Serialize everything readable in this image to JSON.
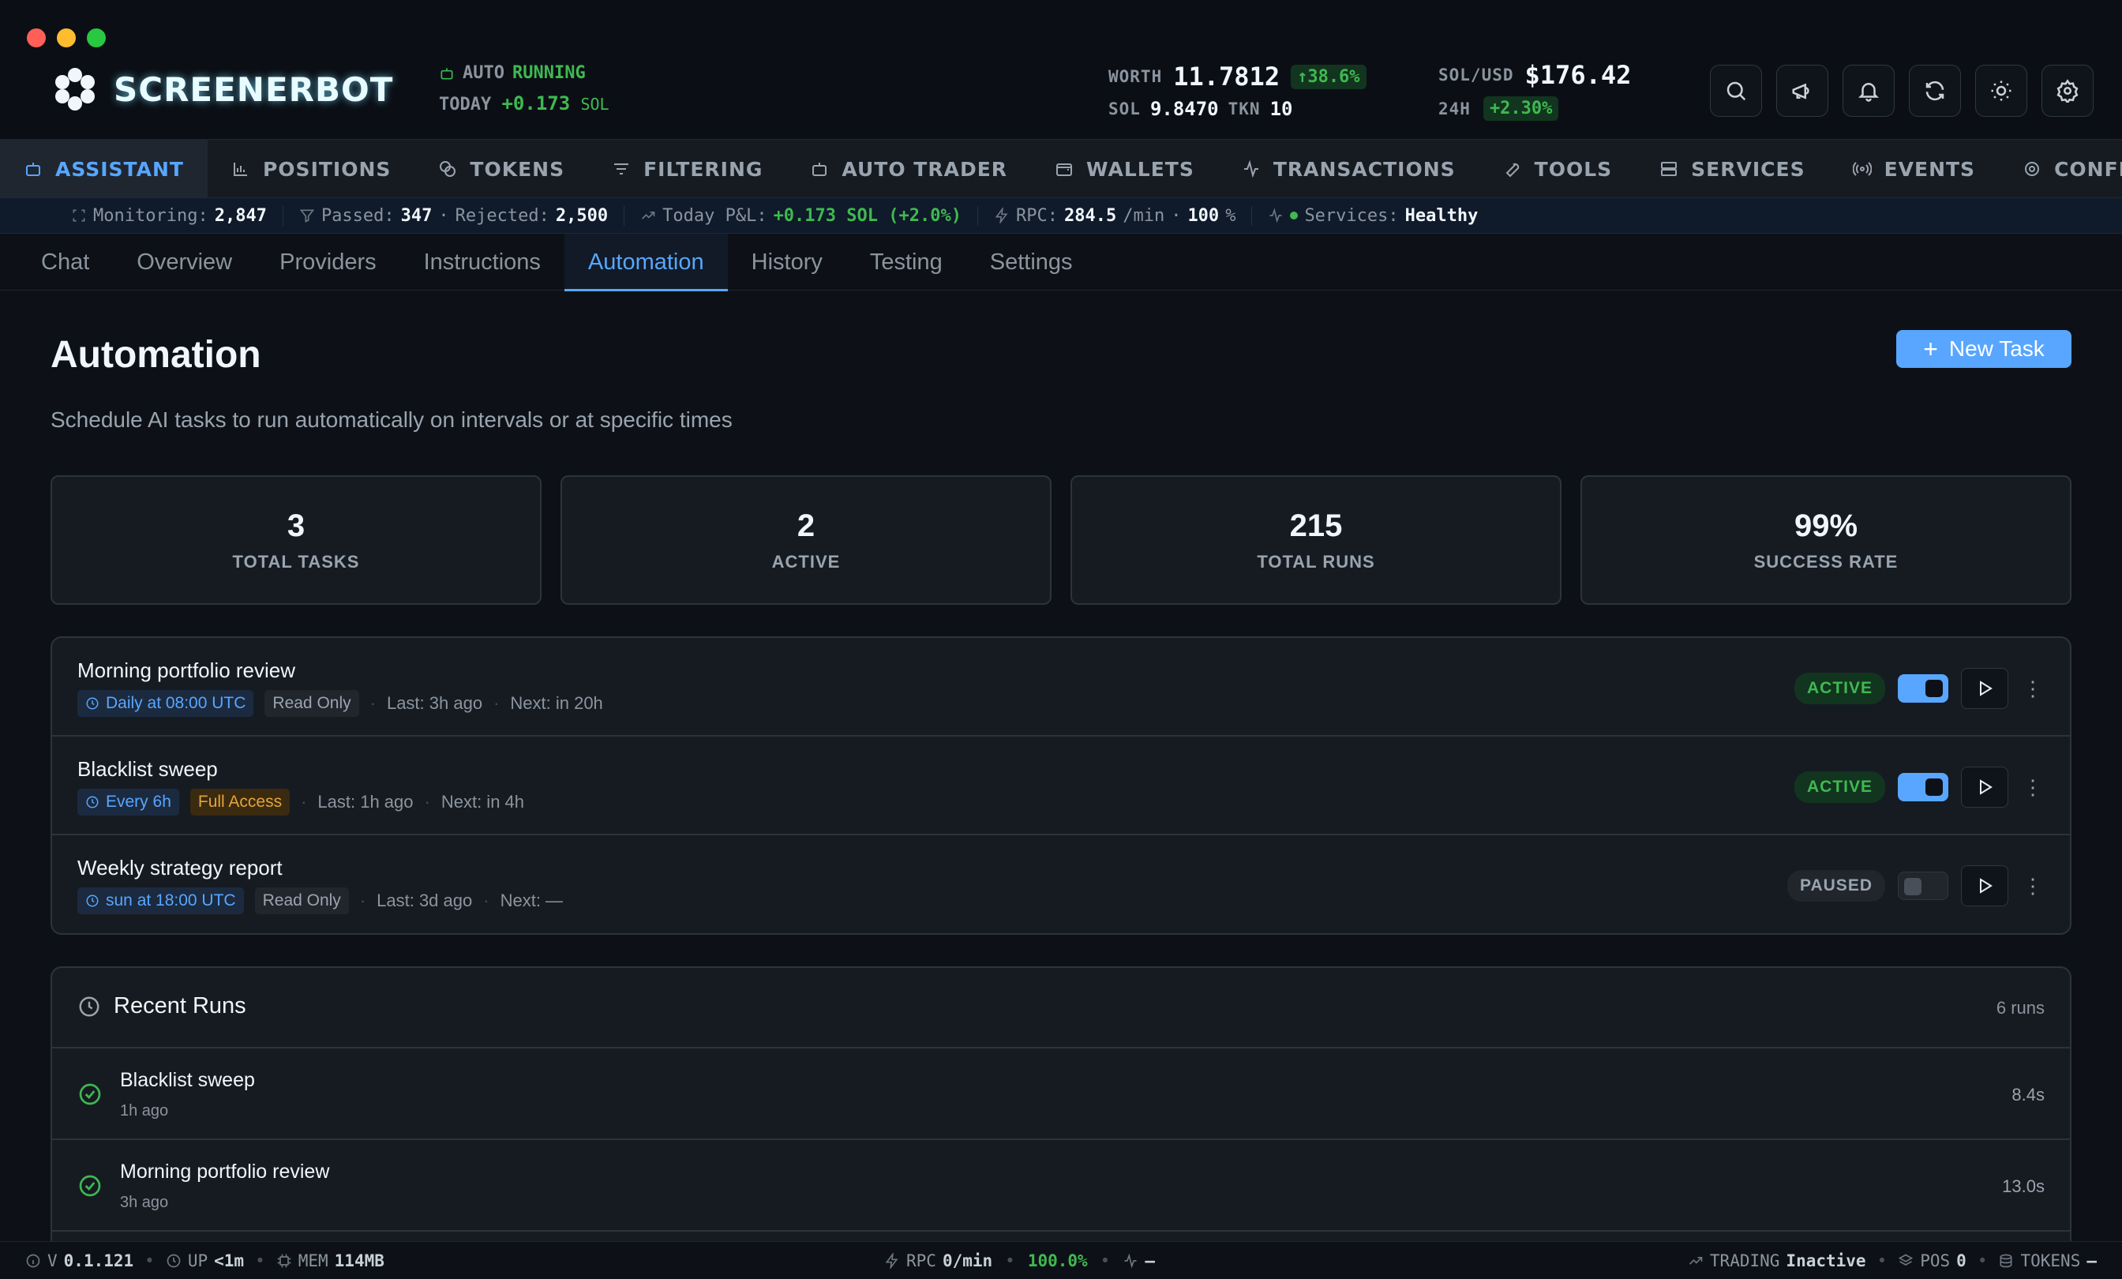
{
  "header": {
    "brand": "SCREENERBOT",
    "auto_label": "AUTO",
    "auto_state": "RUNNING",
    "today_label": "TODAY",
    "today_value": "+0.173",
    "today_unit": "SOL",
    "worth_label": "WORTH",
    "worth_value": "11.7812",
    "worth_change": "↑38.6%",
    "sol_label": "SOL",
    "sol_value": "9.8470",
    "tkn_label": "TKN",
    "tkn_value": "10",
    "solusd_label": "SOL/USD",
    "solusd_value": "$176.42",
    "h24_label": "24H",
    "h24_change": "+2.30%"
  },
  "main_nav": [
    {
      "label": "ASSISTANT",
      "icon": "bot-icon"
    },
    {
      "label": "POSITIONS",
      "icon": "chart-icon"
    },
    {
      "label": "TOKENS",
      "icon": "coins-icon"
    },
    {
      "label": "FILTERING",
      "icon": "filter-icon"
    },
    {
      "label": "AUTO TRADER",
      "icon": "bot-icon"
    },
    {
      "label": "WALLETS",
      "icon": "wallet-icon"
    },
    {
      "label": "TRANSACTIONS",
      "icon": "activity-icon"
    },
    {
      "label": "TOOLS",
      "icon": "wrench-icon"
    },
    {
      "label": "SERVICES",
      "icon": "server-icon"
    },
    {
      "label": "EVENTS",
      "icon": "radio-icon"
    },
    {
      "label": "CONFIG",
      "icon": "gear-icon"
    }
  ],
  "status_strip": {
    "monitoring_label": "Monitoring:",
    "monitoring_value": "2,847",
    "passed_label": "Passed:",
    "passed_value": "347",
    "rejected_label": "Rejected:",
    "rejected_value": "2,500",
    "pnl_label": "Today P&L:",
    "pnl_value": "+0.173 SOL (+2.0%)",
    "rpc_label": "RPC:",
    "rpc_value": "284.5",
    "rpc_unit": "/min",
    "rpc_pct": "100",
    "rpc_pct_unit": "%",
    "services_label": "Services:",
    "services_value": "Healthy"
  },
  "sub_tabs": [
    "Chat",
    "Overview",
    "Providers",
    "Instructions",
    "Automation",
    "History",
    "Testing",
    "Settings"
  ],
  "page": {
    "title": "Automation",
    "subtitle": "Schedule AI tasks to run automatically on intervals or at specific times",
    "new_task_label": "New Task"
  },
  "stats": [
    {
      "value": "3",
      "label": "TOTAL TASKS"
    },
    {
      "value": "2",
      "label": "ACTIVE"
    },
    {
      "value": "215",
      "label": "TOTAL RUNS"
    },
    {
      "value": "99%",
      "label": "SUCCESS RATE"
    }
  ],
  "tasks": [
    {
      "name": "Morning portfolio review",
      "schedule": "Daily at 08:00 UTC",
      "access": "Read Only",
      "last": "Last: 3h ago",
      "next": "Next: in 20h",
      "status": "ACTIVE"
    },
    {
      "name": "Blacklist sweep",
      "schedule": "Every 6h",
      "access": "Full Access",
      "last": "Last: 1h ago",
      "next": "Next: in 4h",
      "status": "ACTIVE"
    },
    {
      "name": "Weekly strategy report",
      "schedule": "sun at 18:00 UTC",
      "access": "Read Only",
      "last": "Last: 3d ago",
      "next": "Next: —",
      "status": "PAUSED"
    }
  ],
  "recent_runs": {
    "title": "Recent Runs",
    "count": "6 runs",
    "items": [
      {
        "name": "Blacklist sweep",
        "time": "1h ago",
        "duration": "8.4s"
      },
      {
        "name": "Morning portfolio review",
        "time": "3h ago",
        "duration": "13.0s"
      }
    ]
  },
  "bottom_bar": {
    "version_label": "V",
    "version_value": "0.1.121",
    "up_label": "UP",
    "up_value": "<1m",
    "mem_label": "MEM",
    "mem_value": "114MB",
    "rpc_label": "RPC",
    "rpc_value": "0/min",
    "success_value": "100.0%",
    "activity_value": "—",
    "trading_label": "TRADING",
    "trading_value": "Inactive",
    "pos_label": "POS",
    "pos_value": "0",
    "tokens_label": "TOKENS",
    "tokens_value": "—"
  }
}
